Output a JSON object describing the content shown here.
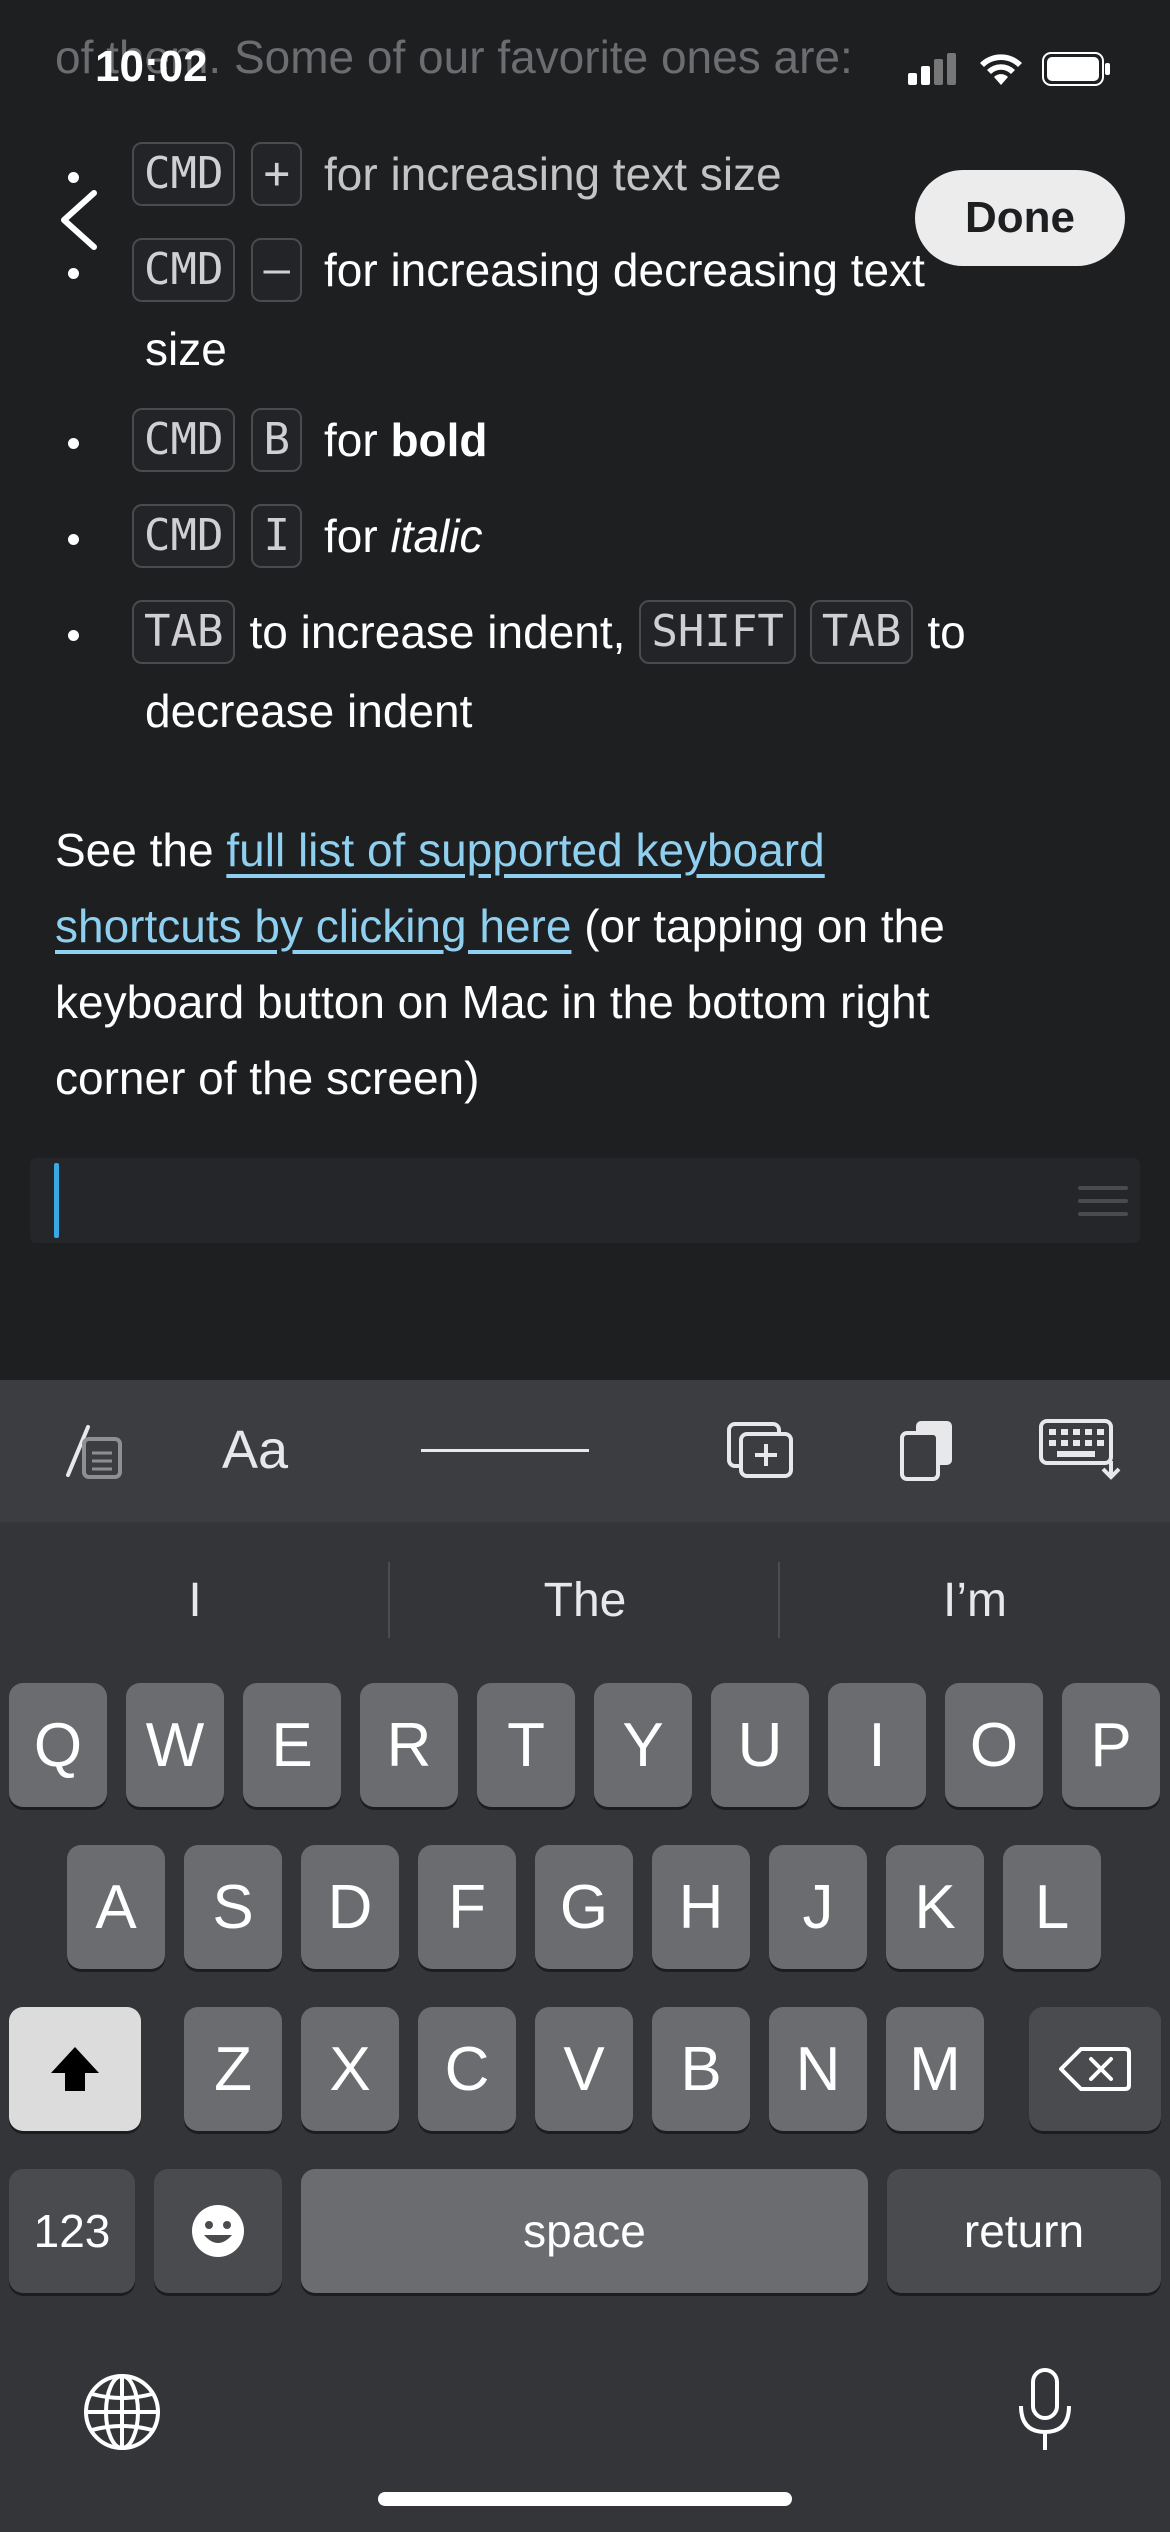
{
  "status_bar": {
    "time": "10:02"
  },
  "nav": {
    "done_label": "Done"
  },
  "editor": {
    "top_partial_text": "of them. Some of our favorite ones are:",
    "shortcuts": [
      {
        "keys": [
          "CMD",
          "+"
        ],
        "text": "for increasing text size"
      },
      {
        "keys": [
          "CMD",
          "–"
        ],
        "text": "for increasing decreasing text",
        "continuation": "size"
      },
      {
        "keys": [
          "CMD",
          "B"
        ],
        "text_prefix": "for ",
        "emphasis": "bold"
      },
      {
        "keys": [
          "CMD",
          "I"
        ],
        "text_prefix": "for ",
        "emphasis": "italic"
      },
      {
        "key1": "TAB",
        "text1": "to increase indent,",
        "key2": "SHIFT",
        "key3": "TAB",
        "text2": "to",
        "continuation": "decrease indent"
      }
    ],
    "paragraph": {
      "prefix": "See the ",
      "link_line1": "full list of supported keyboard",
      "link_line2": "shortcuts by clicking here",
      "suffix_line2": " (or tapping on the",
      "line3": "keyboard button on Mac in the bottom right",
      "line4": "corner of the screen)"
    }
  },
  "toolbar": {
    "items": [
      "edit-note-icon",
      "Aa",
      "horizontal-rule-icon",
      "add-block-icon",
      "paste-icon",
      "dismiss-keyboard-icon"
    ],
    "text_style_label": "Aa"
  },
  "keyboard": {
    "suggestions": [
      "I",
      "The",
      "I’m"
    ],
    "row1": [
      "Q",
      "W",
      "E",
      "R",
      "T",
      "Y",
      "U",
      "I",
      "O",
      "P"
    ],
    "row2": [
      "A",
      "S",
      "D",
      "F",
      "G",
      "H",
      "J",
      "K",
      "L"
    ],
    "row3": [
      "Z",
      "X",
      "C",
      "V",
      "B",
      "N",
      "M"
    ],
    "numbers_label": "123",
    "space_label": "space",
    "return_label": "return"
  },
  "colors": {
    "background": "#1e1f21",
    "link": "#8fd0f1",
    "caret": "#39a9e6",
    "keyboard": "#333538"
  }
}
